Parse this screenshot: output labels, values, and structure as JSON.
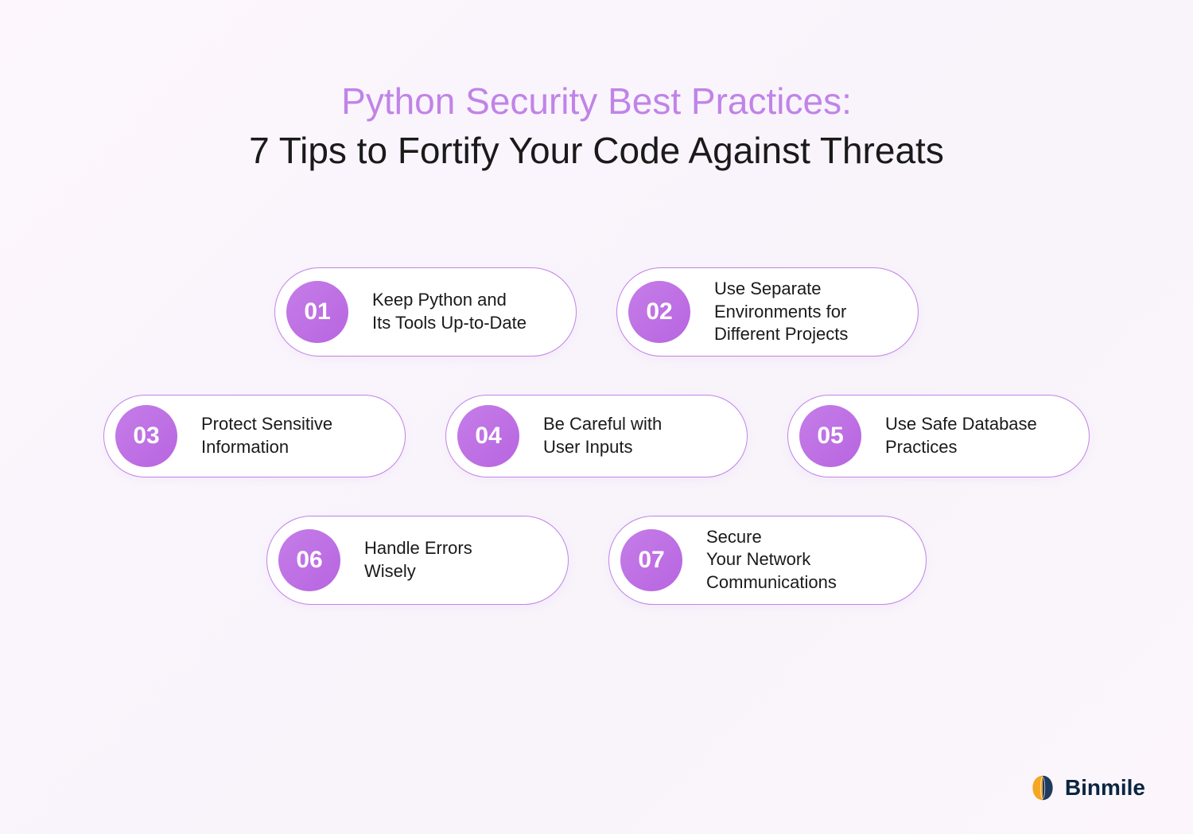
{
  "header": {
    "title_line1": "Python Security Best Practices:",
    "title_line2": "7 Tips to Fortify Your Code Against Threats"
  },
  "tips": [
    {
      "number": "01",
      "text": "Keep Python and Its Tools Up-to-Date"
    },
    {
      "number": "02",
      "text": "Use Separate Environments for Different Projects"
    },
    {
      "number": "03",
      "text": "Protect Sensitive Information"
    },
    {
      "number": "04",
      "text": "Be Careful with User Inputs"
    },
    {
      "number": "05",
      "text": "Use Safe Database Practices"
    },
    {
      "number": "06",
      "text": "Handle Errors Wisely"
    },
    {
      "number": "07",
      "text": "Secure Your Network Communications"
    }
  ],
  "logo": {
    "text": "Binmile"
  },
  "colors": {
    "accent": "#c084e8",
    "circle_gradient_start": "#c57de8",
    "circle_gradient_end": "#b865e0",
    "text_dark": "#1a1a1a",
    "logo_blue": "#0a2540"
  }
}
